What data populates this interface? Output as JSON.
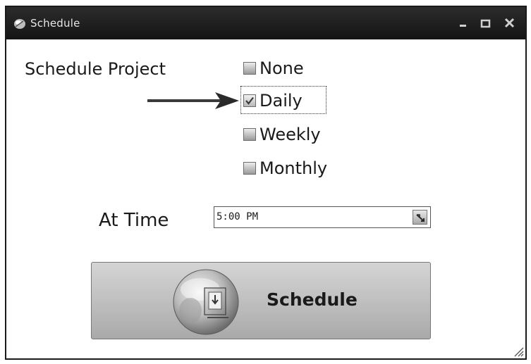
{
  "window": {
    "title": "Schedule",
    "controls": {
      "minimize": "_",
      "maximize": "□",
      "close": "X"
    }
  },
  "form": {
    "section_label": "Schedule Project",
    "options": [
      {
        "label": "None",
        "checked": false
      },
      {
        "label": "Daily",
        "checked": true,
        "focused": true
      },
      {
        "label": "Weekly",
        "checked": false
      },
      {
        "label": "Monthly",
        "checked": false
      }
    ],
    "time_label": "At Time",
    "time_value": "5:00 PM"
  },
  "actions": {
    "schedule_label": "Schedule"
  },
  "icons": {
    "app": "app-logo-icon",
    "arrow": "arrow-right-icon",
    "checkbox_check": "check-icon",
    "time_picker": "clock-picker-icon",
    "schedule": "calendar-disc-icon",
    "resize": "resize-grip-icon"
  },
  "colors": {
    "titlebar": "#1e1e1e",
    "titlebar_text": "#e6e6e6",
    "text": "#1a1a1a",
    "button_face": "#c2c2c2"
  }
}
